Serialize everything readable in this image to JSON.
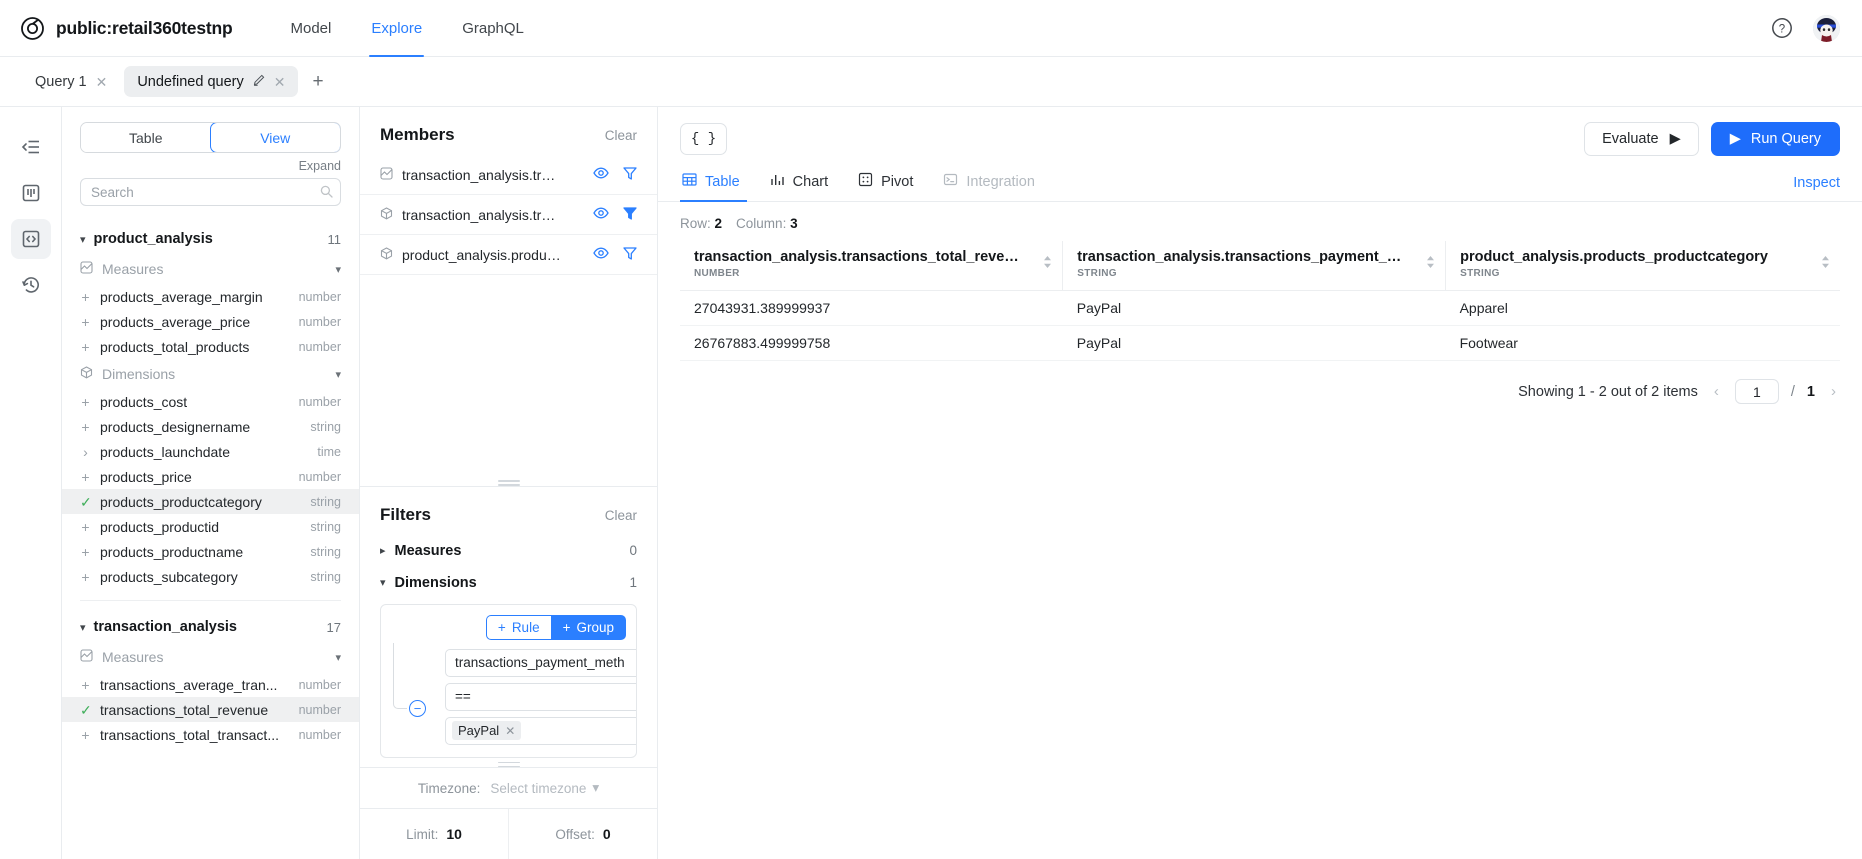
{
  "header": {
    "project_name": "public:retail360testnp",
    "logo_icon": "target-circle-icon",
    "nav": [
      {
        "label": "Model",
        "active": false
      },
      {
        "label": "Explore",
        "active": true
      },
      {
        "label": "GraphQL",
        "active": false
      }
    ],
    "help_icon": "question-circle-icon",
    "avatar_icon": "user-avatar"
  },
  "tabs": {
    "items": [
      {
        "label": "Query 1",
        "active": false,
        "has_pencil": false
      },
      {
        "label": "Undefined query",
        "active": true,
        "has_pencil": true
      }
    ],
    "add_label": "+"
  },
  "rail": {
    "items": [
      {
        "name": "collapse-sidebar-icon",
        "active": false
      },
      {
        "name": "board-icon",
        "active": false
      },
      {
        "name": "code-icon",
        "active": true
      },
      {
        "name": "history-icon",
        "active": false
      }
    ]
  },
  "field_panel": {
    "segmented": [
      {
        "label": "Table",
        "active": false
      },
      {
        "label": "View",
        "active": true
      }
    ],
    "expand_label": "Expand",
    "search_placeholder": "Search",
    "cubes": [
      {
        "name": "product_analysis",
        "count": "11",
        "groups": [
          {
            "label": "Measures",
            "icon": "measure-icon",
            "fields": [
              {
                "name": "products_average_margin",
                "type": "number",
                "state": "add"
              },
              {
                "name": "products_average_price",
                "type": "number",
                "state": "add"
              },
              {
                "name": "products_total_products",
                "type": "number",
                "state": "add"
              }
            ]
          },
          {
            "label": "Dimensions",
            "icon": "dimension-icon",
            "fields": [
              {
                "name": "products_cost",
                "type": "number",
                "state": "add"
              },
              {
                "name": "products_designername",
                "type": "string",
                "state": "add"
              },
              {
                "name": "products_launchdate",
                "type": "time",
                "state": "expand"
              },
              {
                "name": "products_price",
                "type": "number",
                "state": "add"
              },
              {
                "name": "products_productcategory",
                "type": "string",
                "state": "selected"
              },
              {
                "name": "products_productid",
                "type": "string",
                "state": "add"
              },
              {
                "name": "products_productname",
                "type": "string",
                "state": "add"
              },
              {
                "name": "products_subcategory",
                "type": "string",
                "state": "add"
              }
            ]
          }
        ]
      },
      {
        "name": "transaction_analysis",
        "count": "17",
        "groups": [
          {
            "label": "Measures",
            "icon": "measure-icon",
            "fields": [
              {
                "name": "transactions_average_tran...",
                "type": "number",
                "state": "add"
              },
              {
                "name": "transactions_total_revenue",
                "type": "number",
                "state": "selected"
              },
              {
                "name": "transactions_total_transact...",
                "type": "number",
                "state": "add"
              }
            ]
          }
        ]
      }
    ]
  },
  "members_panel": {
    "title": "Members",
    "clear_label": "Clear",
    "rows": [
      {
        "name": "transaction_analysis.tran...",
        "icon": "measure-icon",
        "eye": "eye-icon",
        "filter": "filter-outline-icon"
      },
      {
        "name": "transaction_analysis.tran...",
        "icon": "dimension-icon",
        "eye": "eye-icon",
        "filter": "filter-filled-icon"
      },
      {
        "name": "product_analysis.produc...",
        "icon": "dimension-icon",
        "eye": "eye-icon",
        "filter": "filter-outline-icon"
      }
    ]
  },
  "filters_panel": {
    "title": "Filters",
    "clear_label": "Clear",
    "groups": [
      {
        "label": "Measures",
        "count": "0",
        "expanded": false
      },
      {
        "label": "Dimensions",
        "count": "1",
        "expanded": true
      }
    ],
    "rule_buttons": {
      "rule_label": "Rule",
      "group_label": "Group",
      "plus": "+"
    },
    "rule": {
      "field": "transactions_payment_meth",
      "operator": "==",
      "value_tag": "PayPal",
      "remove_icon": "minus-circle-icon"
    },
    "timezone": {
      "label": "Timezone:",
      "placeholder": "Select timezone"
    },
    "limit": {
      "label": "Limit:",
      "value": "10"
    },
    "offset": {
      "label": "Offset:",
      "value": "0"
    }
  },
  "main": {
    "json_button": "{ }",
    "evaluate_label": "Evaluate",
    "run_label": "Run Query",
    "view_tabs": [
      {
        "label": "Table",
        "icon": "table-icon",
        "active": true,
        "disabled": false
      },
      {
        "label": "Chart",
        "icon": "chart-icon",
        "active": false,
        "disabled": false
      },
      {
        "label": "Pivot",
        "icon": "pivot-icon",
        "active": false,
        "disabled": false
      },
      {
        "label": "Integration",
        "icon": "terminal-icon",
        "active": false,
        "disabled": true
      }
    ],
    "inspect_label": "Inspect",
    "row_label": "Row:",
    "row_count": "2",
    "column_label": "Column:",
    "column_count": "3",
    "table": {
      "columns": [
        {
          "name": "transaction_analysis.transactions_total_revenue",
          "type": "NUMBER"
        },
        {
          "name": "transaction_analysis.transactions_payment_method",
          "type": "STRING"
        },
        {
          "name": "product_analysis.products_productcategory",
          "type": "STRING"
        }
      ],
      "rows": [
        [
          "27043931.389999937",
          "PayPal",
          "Apparel"
        ],
        [
          "26767883.499999758",
          "PayPal",
          "Footwear"
        ]
      ]
    },
    "pagination": {
      "showing": "Showing 1 - 2 out of 2 items",
      "prev": "‹",
      "current_page": "1",
      "separator": "/",
      "total_pages": "1",
      "next": "›"
    }
  },
  "colors": {
    "accent": "#2b7fff",
    "run_button": "#1e6dfb",
    "selected_check": "#3fae5a",
    "border": "#e9ecef"
  }
}
